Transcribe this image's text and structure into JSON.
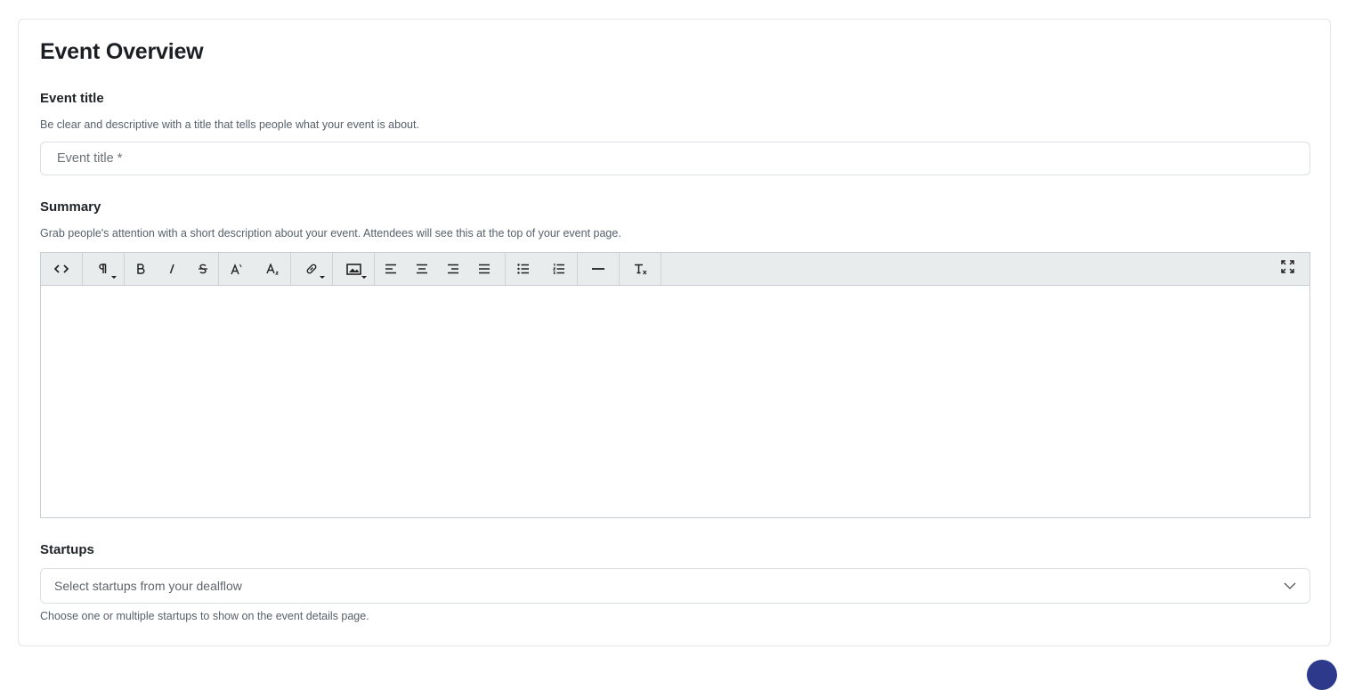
{
  "section": {
    "title": "Event Overview"
  },
  "event_title": {
    "label": "Event title",
    "help": "Be clear and descriptive with a title that tells people what your event is about.",
    "value": "",
    "placeholder": "Event title *"
  },
  "summary": {
    "label": "Summary",
    "help": "Grab people's attention with a short description about your event. Attendees will see this at the top of your event page.",
    "value": "",
    "toolbar": [
      {
        "group": "code",
        "items": [
          "code-view-icon"
        ]
      },
      {
        "group": "format",
        "items": [
          "paragraph-format-icon"
        ]
      },
      {
        "group": "style",
        "items": [
          "bold-icon",
          "italic-icon",
          "strikethrough-icon"
        ]
      },
      {
        "group": "script",
        "items": [
          "superscript-icon",
          "subscript-icon"
        ]
      },
      {
        "group": "link",
        "items": [
          "link-icon"
        ]
      },
      {
        "group": "image",
        "items": [
          "image-icon"
        ]
      },
      {
        "group": "align",
        "items": [
          "align-left-icon",
          "align-center-icon",
          "align-right-icon",
          "align-justify-icon"
        ]
      },
      {
        "group": "lists",
        "items": [
          "bullet-list-icon",
          "numbered-list-icon"
        ]
      },
      {
        "group": "rule",
        "items": [
          "horizontal-rule-icon"
        ]
      },
      {
        "group": "clear",
        "items": [
          "clear-formatting-icon"
        ]
      },
      {
        "group": "view",
        "items": [
          "fullscreen-icon"
        ]
      }
    ]
  },
  "startups": {
    "label": "Startups",
    "placeholder": "Select startups from your dealflow",
    "help": "Choose one or multiple startups to show on the event details page."
  },
  "colors": {
    "toolbar_bg": "#e8eced",
    "border": "#dcdfe3",
    "text": "#1f2328",
    "muted": "#57606a",
    "accent_dot": "#2d3a8c"
  }
}
